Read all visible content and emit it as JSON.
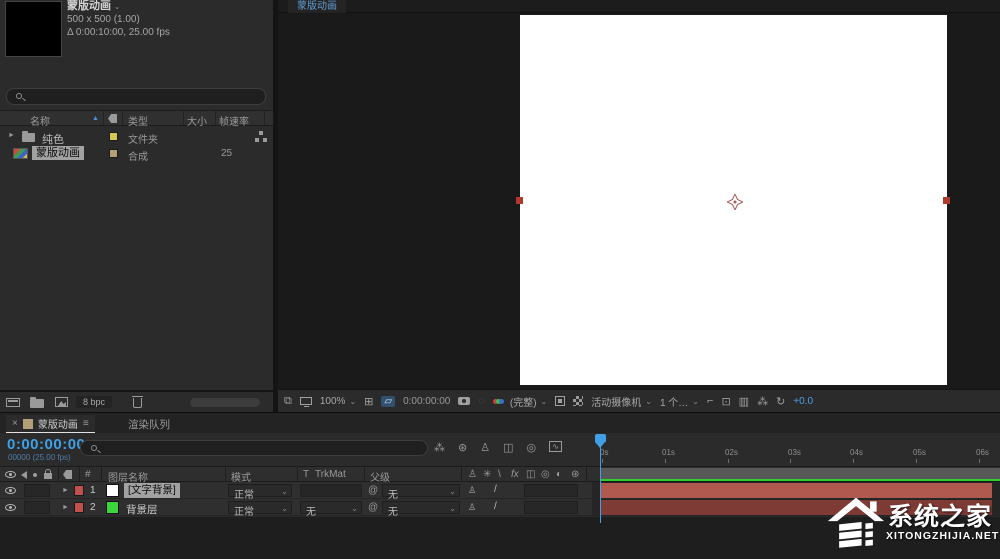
{
  "icons": {
    "sort_up": "▲",
    "chevron": "⌄",
    "close": "×",
    "menu": "≡",
    "expand": "►",
    "delta": "Δ",
    "stack": "⧉",
    "grid": "⊞",
    "roi": "▱",
    "snapshot_ghost": "◌",
    "corner": "⌐",
    "plus_box": "⊡",
    "columns": "▥",
    "tree": "⁂",
    "refresh": "↻",
    "wheel": "⊛",
    "shy": "♙",
    "frames": "◫",
    "blur": "◎",
    "wave": "∿",
    "collapse": "✳",
    "bslash": "\\",
    "fslash": "/",
    "fx": "fx",
    "half_circle": "◐",
    "pickwhip": "@",
    "hash": "#"
  },
  "project_panel": {
    "comp_name": "蒙版动画",
    "comp_dims": "500 x 500 (1.00)",
    "comp_duration": "0:00:10:00, 25.00 fps",
    "columns": {
      "name": "名称",
      "type": "类型",
      "size": "大小",
      "framerate": "帧速率"
    },
    "items": [
      {
        "name": "纯色",
        "type": "文件夹",
        "framerate": ""
      },
      {
        "name": "蒙版动画",
        "type": "合成",
        "framerate": "25"
      }
    ],
    "bit_depth": "8 bpc"
  },
  "viewer": {
    "tab_label": "蒙版动画",
    "zoom": "100%",
    "timecode": "0:00:00:00",
    "resolution": "(完整)",
    "camera": "活动摄像机",
    "views": "1 个…",
    "exposure": "+0.0"
  },
  "timeline": {
    "tab_comp": "蒙版动画",
    "tab_render": "渲染队列",
    "timecode": "0:00:00:00",
    "timecode_sub": "00000 (25.00 fps)",
    "columns": {
      "hash": "#",
      "layer_name": "图层名称",
      "mode": "模式",
      "t": "T",
      "trkmat": "TrkMat",
      "parent": "父级"
    },
    "layers": [
      {
        "num": "1",
        "name": "[文字背景]",
        "mode": "正常",
        "trkmat": "",
        "parent": "无"
      },
      {
        "num": "2",
        "name": "背景层",
        "mode": "正常",
        "trkmat": "无",
        "parent": "无"
      }
    ],
    "ticks": [
      "0s",
      "01s",
      "02s",
      "03s",
      "04s",
      "05s",
      "06s"
    ]
  },
  "watermark": {
    "title": "系统之家",
    "subtitle": "XITONGZHIJIA.NET"
  },
  "colors": {
    "accent_blue": "#3fa0e8",
    "tab_blue": "#5f9dd3",
    "label_red": "#c0504d",
    "swatch_green": "#3cd63c",
    "swatch_white": "#ffffff",
    "bar_red_top": "#b0594f",
    "bar_red_bottom": "#7e3a34",
    "label_tan": "#b3a077",
    "label_yellow": "#d8c850",
    "cache_green": "#2fd12f"
  }
}
